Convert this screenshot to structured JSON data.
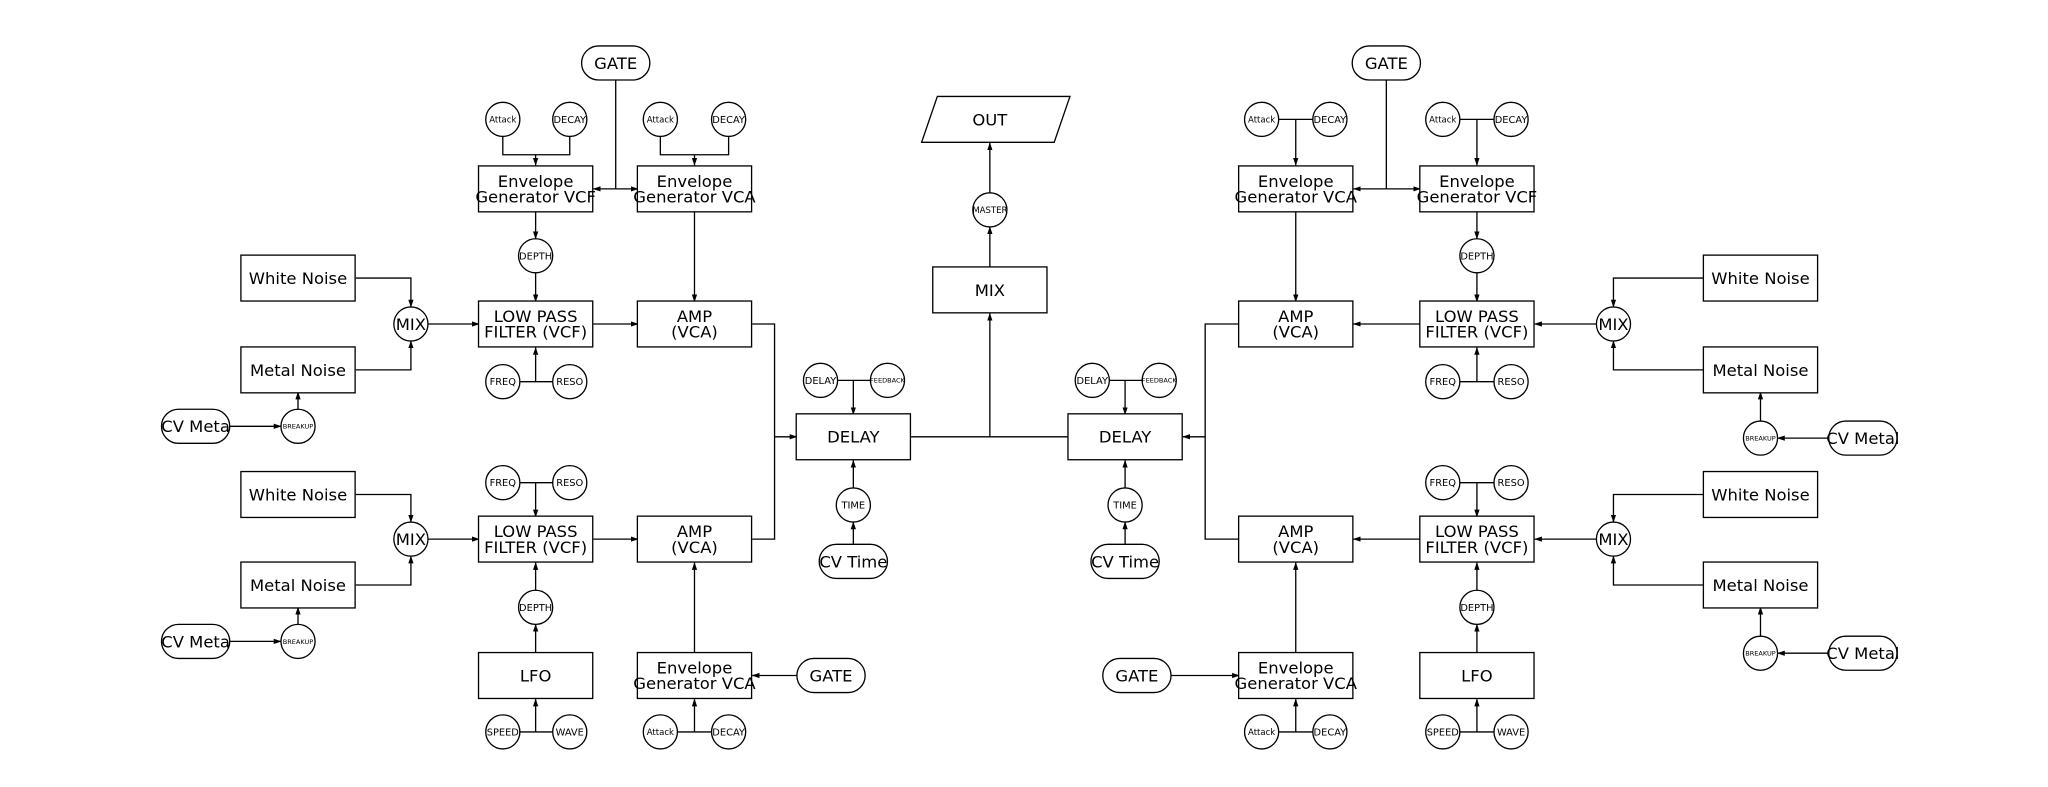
{
  "diagram": {
    "colors": {
      "stroke": "#000000",
      "background": "#ffffff"
    },
    "nodes": {
      "gate_tl": "GATE",
      "attack_tl1": "Attack",
      "decay_tl1": "DECAY",
      "attack_tl2": "Attack",
      "decay_tl2": "DECAY",
      "egvcf_tl": "Envelope\nGenerator VCF",
      "egvca_tl": "Envelope\nGenerator VCA",
      "depth_tl": "DEPTH",
      "wn_tl": "White Noise",
      "mix_tl": "MIX",
      "mn_tl": "Metal Noise",
      "lpf_tl": "LOW PASS\nFILTER (VCF)",
      "amp_tl": "AMP\n(VCA)",
      "freq_tl": "FREQ",
      "reso_tl": "RESO",
      "cvmeta_tl": "CV Meta",
      "breakup_tl": "BREAKUP",
      "freq_bl": "FREQ",
      "reso_bl": "RESO",
      "wn_bl": "White Noise",
      "mix_bl": "MIX",
      "mn_bl": "Metal Noise",
      "lpf_bl": "LOW PASS\nFILTER (VCF)",
      "amp_bl": "AMP\n(VCA)",
      "cvmeta_bl": "CV Meta",
      "breakup_bl": "BREAKUP",
      "depth_bl": "DEPTH",
      "lfo_bl": "LFO",
      "egvca_bl": "Envelope\nGenerator VCA",
      "gate_bl": "GATE",
      "speed_bl": "SPEED",
      "wave_bl": "WAVE",
      "attack_bl": "Attack",
      "decay_bl": "DECAY",
      "out": "OUT",
      "master": "MASTER",
      "mix_c": "MIX",
      "delay_l": "DELAY",
      "delayk_l": "DELAY",
      "feedback_l": "FEEDBACK",
      "time_l": "TIME",
      "cvtime_l": "CV Time",
      "delay_r": "DELAY",
      "delayk_r": "DELAY",
      "feedback_r": "FEEDBACK",
      "time_r": "TIME",
      "cvtime_r": "CV Time",
      "gate_tr": "GATE",
      "attack_tr1": "Attack",
      "decay_tr1": "DECAY",
      "attack_tr2": "Attack",
      "decay_tr2": "DECAY",
      "egvca_tr": "Envelope\nGenerator VCA",
      "egvcf_tr": "Envelope\nGenerator VCF",
      "depth_tr": "DEPTH",
      "amp_tr": "AMP\n(VCA)",
      "lpf_tr": "LOW PASS\nFILTER (VCF)",
      "mix_tr": "MIX",
      "wn_tr": "White Noise",
      "mn_tr": "Metal Noise",
      "freq_tr": "FREQ",
      "reso_tr": "RESO",
      "breakup_tr": "BREAKUP",
      "cvmetal_tr": "CV Metal",
      "freq_br": "FREQ",
      "reso_br": "RESO",
      "amp_br": "AMP\n(VCA)",
      "lpf_br": "LOW PASS\nFILTER (VCF)",
      "mix_br": "MIX",
      "wn_br": "White Noise",
      "mn_br": "Metal Noise",
      "depth_br": "DEPTH",
      "breakup_br": "BREAKUP",
      "cvmetal_br": "CV Metal",
      "gate_br": "GATE",
      "egvca_br": "Envelope\nGenerator VCA",
      "lfo_br": "LFO",
      "attack_br": "Attack",
      "decay_br": "DECAY",
      "speed_br": "SPEED",
      "wave_br": "WAVE"
    }
  }
}
